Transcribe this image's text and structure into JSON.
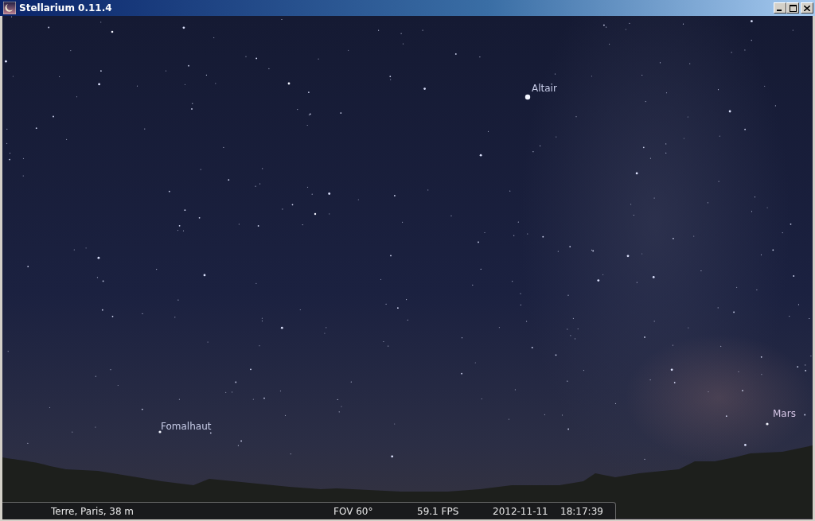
{
  "window": {
    "title": "Stellarium 0.11.4"
  },
  "sky": {
    "labels": [
      {
        "name": "Altair"
      },
      {
        "name": "Fomalhaut"
      },
      {
        "name": "Mars"
      }
    ]
  },
  "status_bar": {
    "location": "Terre, Paris, 38 m",
    "fov": "FOV 60°",
    "fps": "59.1 FPS",
    "date": "2012-11-11",
    "time": "18:17:39"
  }
}
